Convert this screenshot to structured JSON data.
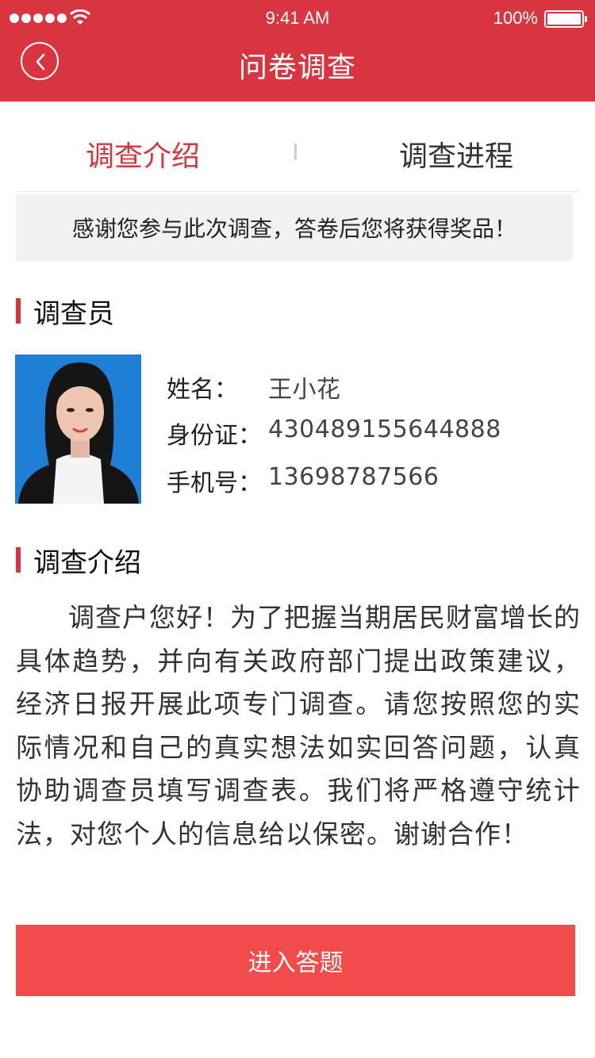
{
  "status_bar": {
    "time": "9:41 AM",
    "battery": "100%"
  },
  "header": {
    "title": "问卷调查"
  },
  "tabs": [
    {
      "label": "调查介绍",
      "active": true
    },
    {
      "label": "调查进程",
      "active": false
    }
  ],
  "notice": "感谢您参与此次调查，答卷后您将获得奖品！",
  "investigator": {
    "section_title": "调查员",
    "fields": [
      {
        "key": "姓名：",
        "value": "王小花"
      },
      {
        "key": "身份证：",
        "value": "430489155644888"
      },
      {
        "key": "手机号：",
        "value": "13698787566"
      }
    ]
  },
  "intro": {
    "section_title": "调查介绍",
    "text": "调查户您好！为了把握当期居民财富增长的具体趋势，并向有关政府部门提出政策建议，经济日报开展此项专门调查。请您按照您的实际情况和自己的真实想法如实回答问题，认真协助调查员填写调查表。我们将严格遵守统计法，对您个人的信息给以保密。谢谢合作！"
  },
  "enter_button": "进入答题",
  "colors": {
    "brand": "#d93541",
    "button": "#f24b4b"
  }
}
